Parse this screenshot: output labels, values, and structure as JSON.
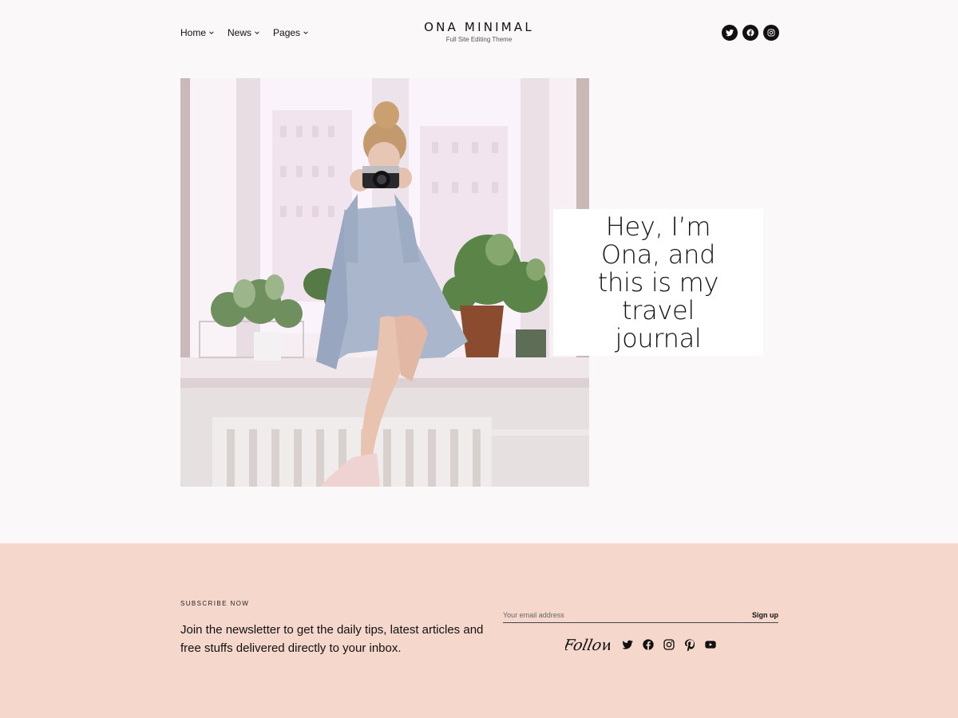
{
  "nav": {
    "items": [
      {
        "label": "Home"
      },
      {
        "label": "News"
      },
      {
        "label": "Pages"
      }
    ]
  },
  "brand": {
    "title": "ONA MINIMAL",
    "subtitle": "Full Site Editing Theme"
  },
  "header_social": [
    "twitter-icon",
    "facebook-icon",
    "instagram-icon"
  ],
  "hero": {
    "heading": "Hey, I’m Ona, and this is my travel journal"
  },
  "newsletter": {
    "label": "SUBSCRIBE NOW",
    "description": "Join the newsletter to get the daily tips, latest articles and free stuffs delivered directly to your inbox.",
    "email_placeholder": "Your email address",
    "signup_label": "Sign up",
    "follow_label": "Follow",
    "social": [
      "twitter-icon",
      "facebook-icon",
      "instagram-icon",
      "pinterest-icon",
      "youtube-icon"
    ]
  },
  "colors": {
    "page_bg": "#fbf8f9",
    "footer_bg": "#f5d7cb",
    "text": "#111111"
  }
}
